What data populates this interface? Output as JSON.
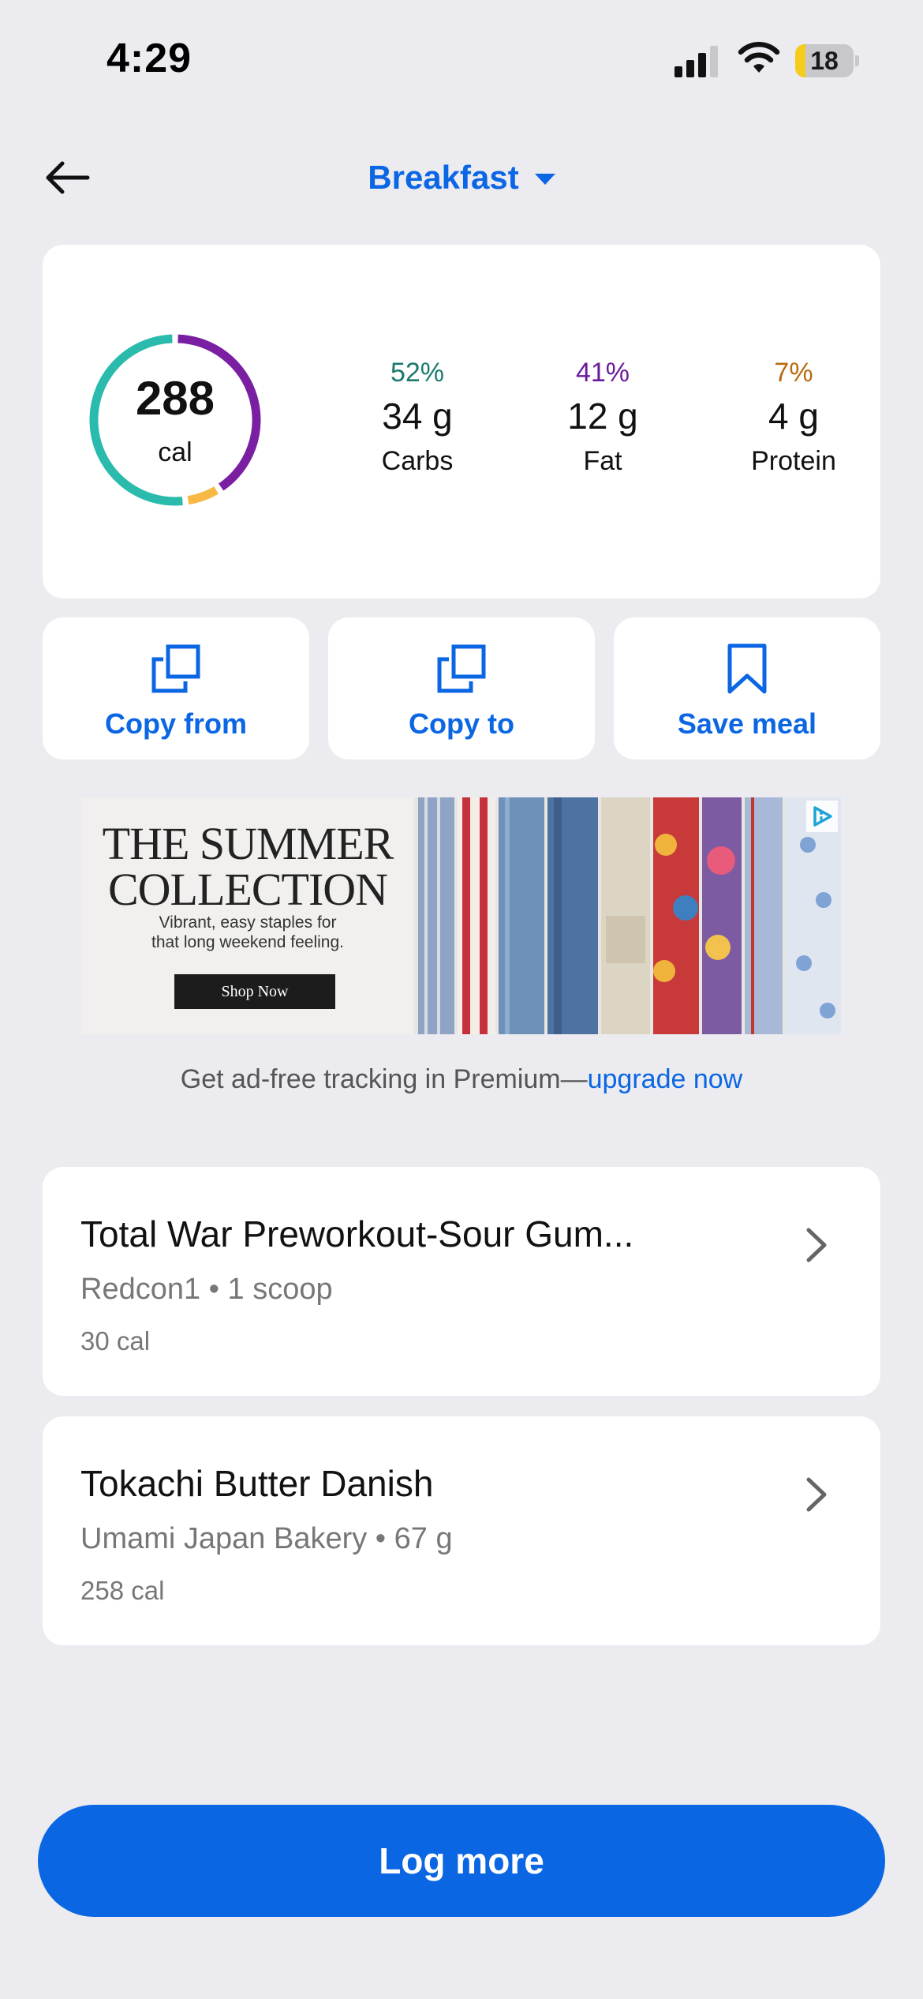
{
  "status_bar": {
    "time": "4:29",
    "battery_level": "18",
    "battery_fraction": 0.18,
    "icons": [
      "signal-icon",
      "wifi-icon",
      "battery-icon"
    ]
  },
  "header": {
    "back_icon": "arrow-left-icon",
    "meal_title": "Breakfast",
    "dropdown_icon": "caret-down-icon"
  },
  "summary": {
    "calories": "288",
    "calories_unit": "cal",
    "ring_fractions": {
      "carbs": 0.52,
      "fat": 0.41,
      "protein": 0.07
    },
    "macros": {
      "carbs": {
        "percent": "52%",
        "grams": "34 g",
        "label": "Carbs",
        "color": "#1a7a6c"
      },
      "fat": {
        "percent": "41%",
        "grams": "12 g",
        "label": "Fat",
        "color": "#6a1b9a"
      },
      "protein": {
        "percent": "7%",
        "grams": "4 g",
        "label": "Protein",
        "color": "#b86b10"
      }
    },
    "ring_colors": {
      "carbs": "#2bbbad",
      "fat": "#7b1fa2",
      "protein": "#f7b844"
    }
  },
  "actions": {
    "copy_from": {
      "label": "Copy from",
      "icon": "copy-icon"
    },
    "copy_to": {
      "label": "Copy to",
      "icon": "copy-icon"
    },
    "save_meal": {
      "label": "Save meal",
      "icon": "bookmark-icon"
    }
  },
  "ad": {
    "headline": "THE SUMMER\nCOLLECTION",
    "subline": "Vibrant, easy staples for\nthat long weekend feeling.",
    "cta": "Shop Now",
    "icon": "ad-choices-icon"
  },
  "premium": {
    "text": "Get ad-free tracking in Premium—",
    "link": "upgrade now"
  },
  "foods": [
    {
      "name": "Total War Preworkout-Sour Gum...",
      "detail": "Redcon1 • 1 scoop",
      "calories": "30 cal"
    },
    {
      "name": "Tokachi Butter Danish",
      "detail": "Umami Japan Bakery • 67 g",
      "calories": "258 cal"
    }
  ],
  "log_more": {
    "label": "Log more"
  },
  "colors": {
    "accent": "#0b66e4",
    "background": "#ebebf0",
    "card": "#ffffff"
  }
}
